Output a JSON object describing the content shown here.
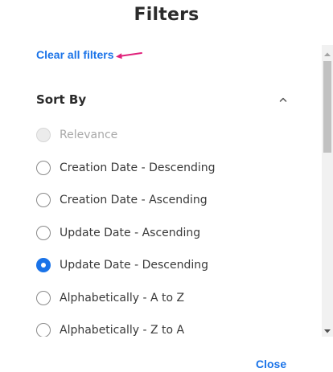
{
  "dialog": {
    "title": "Filters",
    "clear_all_label": "Clear all filters",
    "close_label": "Close"
  },
  "sort_section": {
    "title": "Sort By",
    "expanded": true,
    "toggle_icon": "chevron-up-icon",
    "options": [
      {
        "label": "Relevance",
        "state": "disabled"
      },
      {
        "label": "Creation Date - Descending",
        "state": "unchecked"
      },
      {
        "label": "Creation Date - Ascending",
        "state": "unchecked"
      },
      {
        "label": "Update Date - Ascending",
        "state": "unchecked"
      },
      {
        "label": "Update Date - Descending",
        "state": "checked"
      },
      {
        "label": "Alphabetically - A to Z",
        "state": "unchecked"
      },
      {
        "label": "Alphabetically - Z to A",
        "state": "unchecked"
      }
    ]
  },
  "colors": {
    "accent": "#1a73e8",
    "annotation_arrow": "#e0217a",
    "text": "#3a3a3a",
    "disabled_text": "#a8a8a8"
  }
}
